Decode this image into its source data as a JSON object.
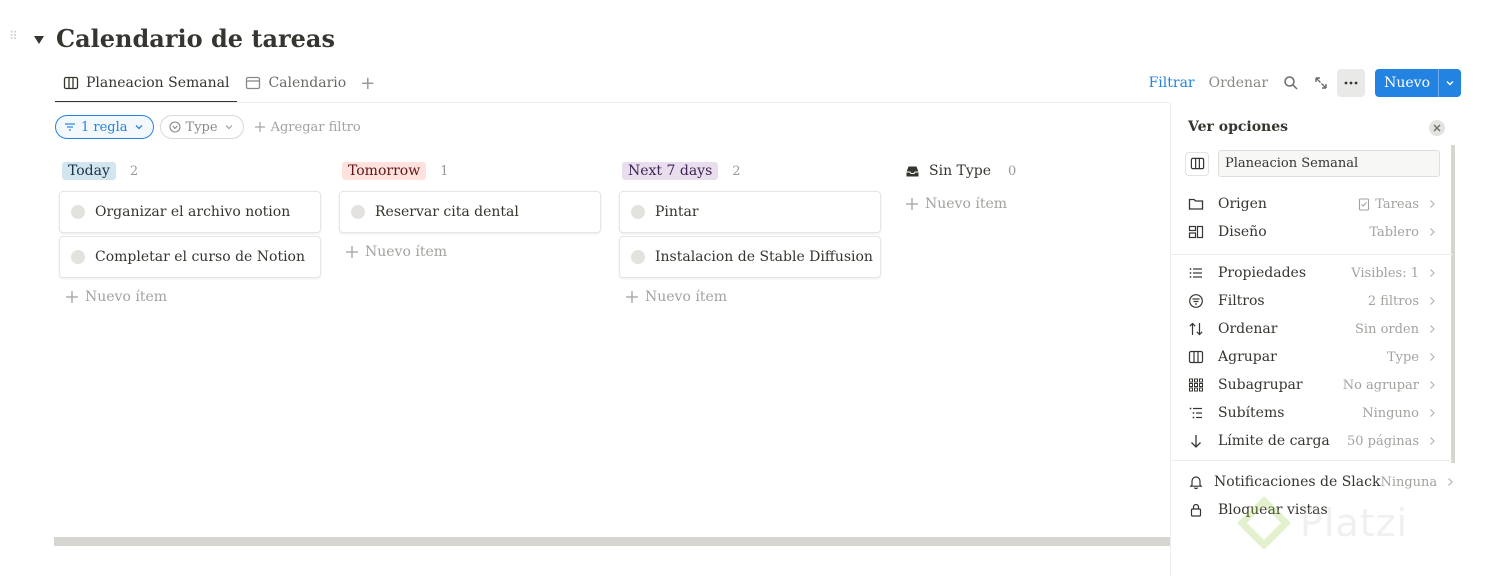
{
  "page": {
    "title": "Calendario de tareas"
  },
  "tabs": [
    {
      "label": "Planeacion Semanal",
      "icon": "board-icon",
      "active": true
    },
    {
      "label": "Calendario",
      "icon": "calendar-icon",
      "active": false
    }
  ],
  "toolbar": {
    "filter_label": "Filtrar",
    "sort_label": "Ordenar",
    "new_label": "Nuevo"
  },
  "filters": {
    "rule_label": "1 regla",
    "type_label": "Type",
    "add_filter_label": "Agregar filtro"
  },
  "board": {
    "new_item_label": "Nuevo ítem",
    "columns": [
      {
        "label": "Today",
        "count": "2",
        "tag_bg": "#d3e5ef",
        "tag_color": "#183347",
        "cards": [
          "Organizar el archivo notion",
          "Completar el curso de Notion"
        ]
      },
      {
        "label": "Tomorrow",
        "count": "1",
        "tag_bg": "#ffe2dd",
        "tag_color": "#5d1715",
        "cards": [
          "Reservar cita dental"
        ]
      },
      {
        "label": "Next 7 days",
        "count": "2",
        "tag_bg": "#e8deee",
        "tag_color": "#412454",
        "cards": [
          "Pintar",
          "Instalacion de Stable Diffusion"
        ]
      },
      {
        "label": "Sin Type",
        "count": "0",
        "cards": []
      }
    ]
  },
  "options_panel": {
    "title": "Ver opciones",
    "view_name": "Planeacion Semanal",
    "items": [
      {
        "label": "Origen",
        "value": "Tareas",
        "icon": "folder-icon"
      },
      {
        "label": "Diseño",
        "value": "Tablero",
        "icon": "layout-icon"
      },
      {
        "label": "Propiedades",
        "value": "Visibles: 1",
        "icon": "list-icon"
      },
      {
        "label": "Filtros",
        "value": "2 filtros",
        "icon": "filter-icon"
      },
      {
        "label": "Ordenar",
        "value": "Sin orden",
        "icon": "sort-icon"
      },
      {
        "label": "Agrupar",
        "value": "Type",
        "icon": "group-icon"
      },
      {
        "label": "Subagrupar",
        "value": "No agrupar",
        "icon": "subgroup-icon"
      },
      {
        "label": "Subítems",
        "value": "Ninguno",
        "icon": "subitems-icon"
      },
      {
        "label": "Límite de carga",
        "value": "50 páginas",
        "icon": "arrow-down-icon"
      },
      {
        "label": "Notificaciones de Slack",
        "value": "Ninguna",
        "icon": "bell-icon"
      },
      {
        "label": "Bloquear vistas",
        "value": "",
        "icon": "lock-icon"
      }
    ]
  },
  "watermark": {
    "text": "Platzi"
  },
  "colors": {
    "accent": "#2383e2",
    "text": "#37352f",
    "muted": "#9b9a97"
  }
}
